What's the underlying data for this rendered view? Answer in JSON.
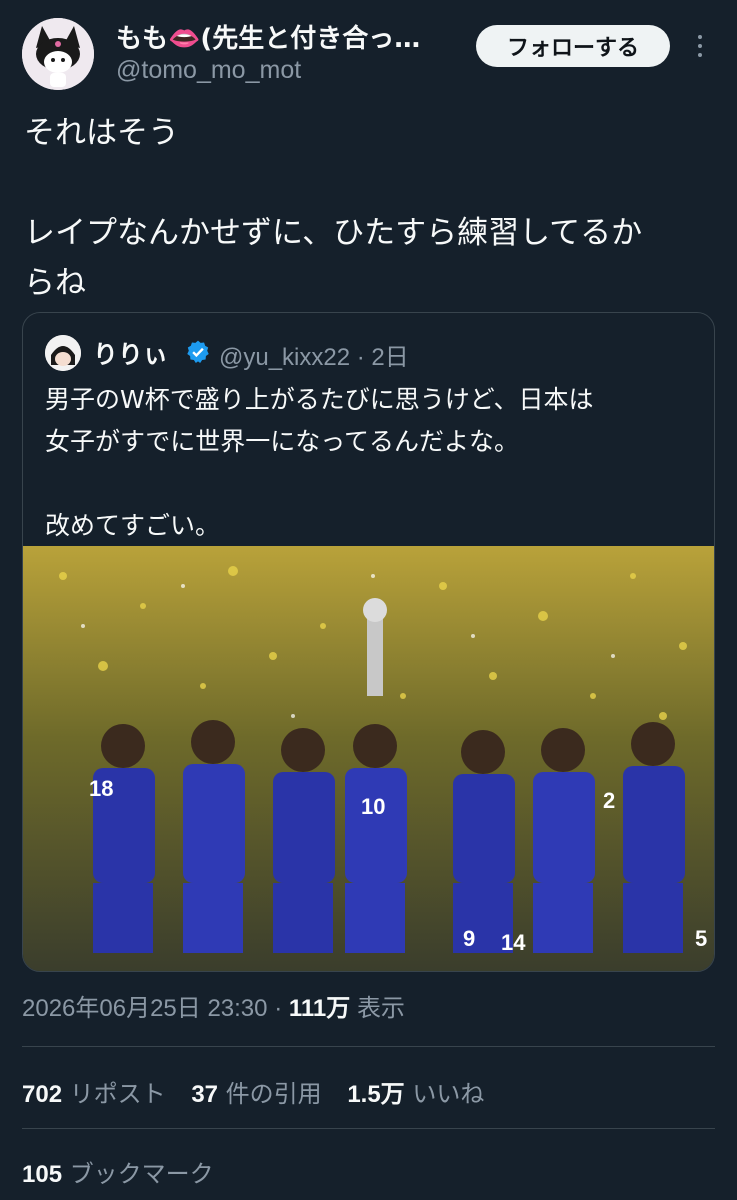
{
  "author": {
    "display_name": "もも👄(先生と付き合っ…",
    "handle": "@tomo_mo_mot",
    "follow_label": "フォローする"
  },
  "tweet": {
    "text": "それはそう\n\nレイプなんかせずに、ひたすら練習してるか\nらね"
  },
  "quoted": {
    "name": "りりぃ",
    "handle_time": "@yu_kixx22 · 2日",
    "text": "男子のW杯で盛り上がるたびに思うけど、日本は\n女子がすでに世界一になってるんだよな。\n\n改めてすごい。",
    "image_alt": "photo",
    "jersey_numbers": [
      "18",
      "10",
      "2",
      "9",
      "14",
      "5"
    ]
  },
  "meta": {
    "datetime": "2026年06月25日 23:30",
    "separator": "·",
    "views_count": "111万",
    "views_label": "表示"
  },
  "stats": {
    "reposts_count": "702",
    "reposts_label": "リポスト",
    "quotes_count": "37",
    "quotes_label": "件の引用",
    "likes_count": "1.5万",
    "likes_label": "いいね",
    "bookmarks_count": "105",
    "bookmarks_label": "ブックマーク"
  },
  "colors": {
    "background": "#15202b",
    "text": "#f7f9f9",
    "secondary": "#8b98a5",
    "border": "#38444d",
    "verified": "#1d9bf0",
    "jersey": "#2a34a8"
  }
}
